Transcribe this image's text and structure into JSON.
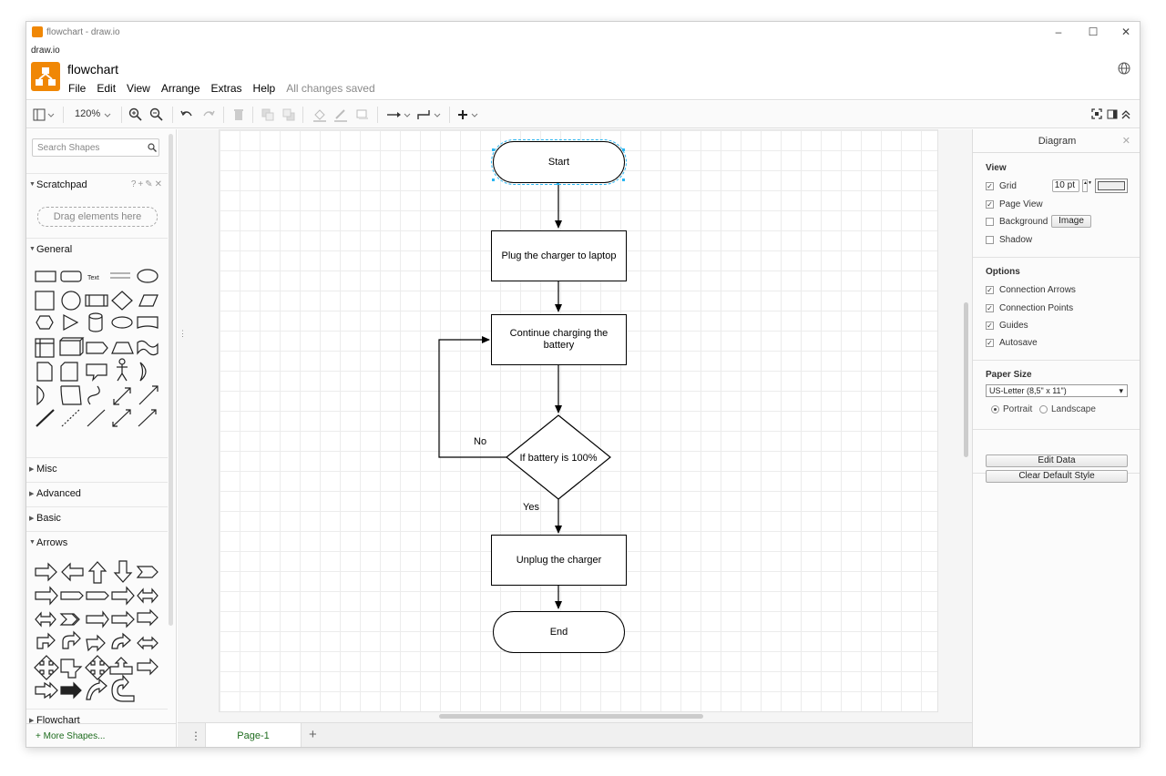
{
  "window": {
    "title": "flowchart - draw.io",
    "app_label": "draw.io"
  },
  "header": {
    "doc_title": "flowchart",
    "menus": [
      "File",
      "Edit",
      "View",
      "Arrange",
      "Extras",
      "Help"
    ],
    "status": "All changes saved"
  },
  "toolbar": {
    "zoom": "120%"
  },
  "sidebar": {
    "search_placeholder": "Search Shapes",
    "scratchpad": "Scratchpad",
    "scratchpad_tools": "?+✎✕",
    "dropzone": "Drag elements here",
    "sections": {
      "general": "General",
      "misc": "Misc",
      "advanced": "Advanced",
      "basic": "Basic",
      "arrows": "Arrows",
      "flowchart": "Flowchart"
    },
    "general_text_shape": "Text",
    "more_shapes": "+ More Shapes..."
  },
  "pages": {
    "tab": "Page-1"
  },
  "diagram": {
    "nodes": {
      "start": "Start",
      "plug": "Plug the charger to laptop",
      "continue": "Continue charging the battery",
      "decision": "If battery is 100%",
      "unplug": "Unplug the charger",
      "end": "End"
    },
    "labels": {
      "no": "No",
      "yes": "Yes"
    }
  },
  "format_panel": {
    "title": "Diagram",
    "view": {
      "heading": "View",
      "grid": "Grid",
      "grid_size": "10 pt",
      "page_view": "Page View",
      "background": "Background",
      "image_button": "Image",
      "shadow": "Shadow"
    },
    "options": {
      "heading": "Options",
      "connection_arrows": "Connection Arrows",
      "connection_points": "Connection Points",
      "guides": "Guides",
      "autosave": "Autosave"
    },
    "paper": {
      "heading": "Paper Size",
      "selected": "US-Letter (8,5\" x 11\")",
      "portrait": "Portrait",
      "landscape": "Landscape"
    },
    "buttons": {
      "edit_data": "Edit Data",
      "clear_style": "Clear Default Style"
    }
  },
  "colors": {
    "accent": "#f08705",
    "link_green": "#1d6b1d"
  }
}
